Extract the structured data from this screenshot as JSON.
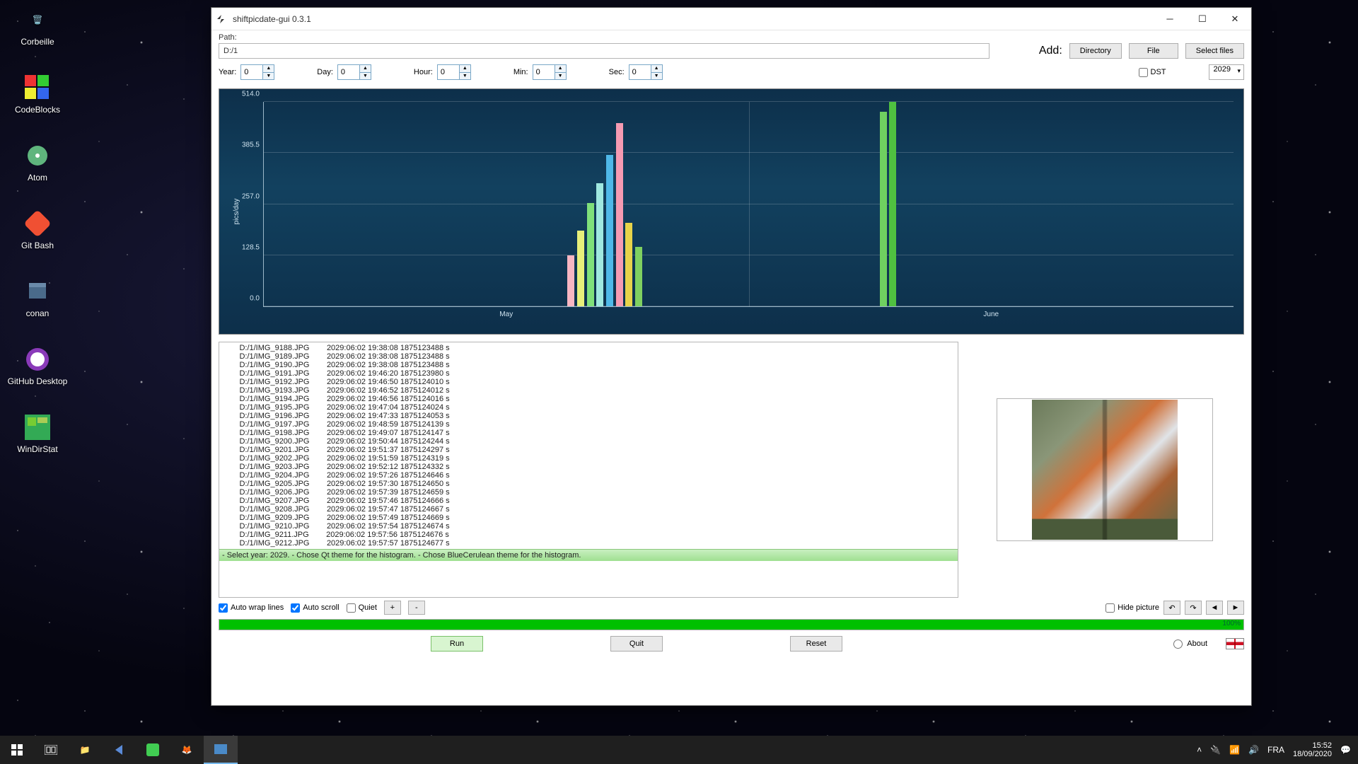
{
  "desktop": {
    "icons": [
      "Corbeille",
      "CodeBlocks",
      "Atom",
      "Git Bash",
      "conan",
      "GitHub Desktop",
      "WinDirStat"
    ]
  },
  "taskbar": {
    "lang": "FRA",
    "time": "15:52",
    "date": "18/09/2020"
  },
  "window": {
    "title": "shiftpicdate-gui 0.3.1"
  },
  "toolbar": {
    "path_label": "Path:",
    "path_value": "D:/1",
    "add_label": "Add:",
    "directory": "Directory",
    "file": "File",
    "select_files": "Select files",
    "year_label": "Year:",
    "day_label": "Day:",
    "hour_label": "Hour:",
    "min_label": "Min:",
    "sec_label": "Sec:",
    "year_v": "0",
    "day_v": "0",
    "hour_v": "0",
    "min_v": "0",
    "sec_v": "0",
    "dst": "DST",
    "year_select": "2029"
  },
  "chart_data": {
    "type": "bar",
    "ylabel": "pics/day",
    "ylim": [
      0,
      514
    ],
    "yticks": [
      "0.0",
      "128.5",
      "257.0",
      "385.5",
      "514.0"
    ],
    "xticks": [
      "May",
      "June"
    ],
    "bars": [
      {
        "x_rel": 0.313,
        "value": 128,
        "color": "#f7b6c2"
      },
      {
        "x_rel": 0.323,
        "value": 190,
        "color": "#e7f07a"
      },
      {
        "x_rel": 0.333,
        "value": 260,
        "color": "#7fe07a"
      },
      {
        "x_rel": 0.343,
        "value": 310,
        "color": "#9fe8e0"
      },
      {
        "x_rel": 0.353,
        "value": 380,
        "color": "#4fb8e8"
      },
      {
        "x_rel": 0.363,
        "value": 460,
        "color": "#f59ab2"
      },
      {
        "x_rel": 0.373,
        "value": 210,
        "color": "#e7d34a"
      },
      {
        "x_rel": 0.383,
        "value": 150,
        "color": "#7fd060"
      },
      {
        "x_rel": 0.635,
        "value": 490,
        "color": "#6fd060"
      },
      {
        "x_rel": 0.645,
        "value": 514,
        "color": "#4fc040"
      }
    ]
  },
  "log": {
    "lines": [
      "D:/1/IMG_9188.JPG        2029:06:02 19:38:08 1875123488 s",
      "D:/1/IMG_9189.JPG        2029:06:02 19:38:08 1875123488 s",
      "D:/1/IMG_9190.JPG        2029:06:02 19:38:08 1875123488 s",
      "D:/1/IMG_9191.JPG        2029:06:02 19:46:20 1875123980 s",
      "D:/1/IMG_9192.JPG        2029:06:02 19:46:50 1875124010 s",
      "D:/1/IMG_9193.JPG        2029:06:02 19:46:52 1875124012 s",
      "D:/1/IMG_9194.JPG        2029:06:02 19:46:56 1875124016 s",
      "D:/1/IMG_9195.JPG        2029:06:02 19:47:04 1875124024 s",
      "D:/1/IMG_9196.JPG        2029:06:02 19:47:33 1875124053 s",
      "D:/1/IMG_9197.JPG        2029:06:02 19:48:59 1875124139 s",
      "D:/1/IMG_9198.JPG        2029:06:02 19:49:07 1875124147 s",
      "D:/1/IMG_9200.JPG        2029:06:02 19:50:44 1875124244 s",
      "D:/1/IMG_9201.JPG        2029:06:02 19:51:37 1875124297 s",
      "D:/1/IMG_9202.JPG        2029:06:02 19:51:59 1875124319 s",
      "D:/1/IMG_9203.JPG        2029:06:02 19:52:12 1875124332 s",
      "D:/1/IMG_9204.JPG        2029:06:02 19:57:26 1875124646 s",
      "D:/1/IMG_9205.JPG        2029:06:02 19:57:30 1875124650 s",
      "D:/1/IMG_9206.JPG        2029:06:02 19:57:39 1875124659 s",
      "D:/1/IMG_9207.JPG        2029:06:02 19:57:46 1875124666 s",
      "D:/1/IMG_9208.JPG        2029:06:02 19:57:47 1875124667 s",
      "D:/1/IMG_9209.JPG        2029:06:02 19:57:49 1875124669 s",
      "D:/1/IMG_9210.JPG        2029:06:02 19:57:54 1875124674 s",
      "D:/1/IMG_9211.JPG        2029:06:02 19:57:56 1875124676 s",
      "D:/1/IMG_9212.JPG        2029:06:02 19:57:57 1875124677 s"
    ],
    "status": [
      "- Select year: 2029.",
      "- Chose Qt theme for the histogram.",
      "- Chose BlueCerulean theme for the histogram."
    ]
  },
  "opts": {
    "auto_wrap": "Auto wrap lines",
    "auto_scroll": "Auto scroll",
    "quiet": "Quiet",
    "plus": "+",
    "minus": "-",
    "hide_picture": "Hide picture",
    "rot_ccw": "↶",
    "rot_cw": "↷",
    "prev": "◄",
    "next": "►"
  },
  "progress": {
    "pct": "100%"
  },
  "bottom": {
    "run": "Run",
    "quit": "Quit",
    "reset": "Reset",
    "about": "About"
  }
}
